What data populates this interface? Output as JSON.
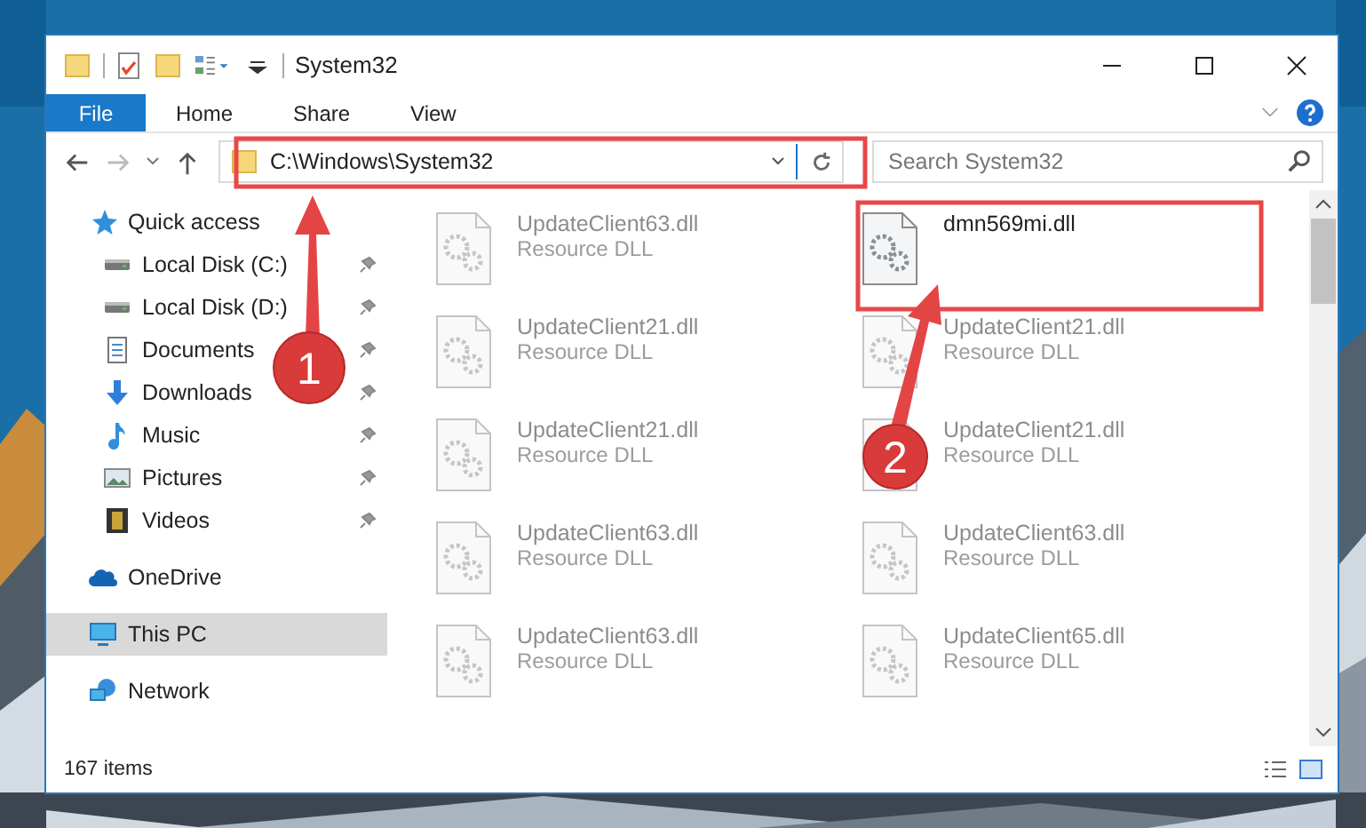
{
  "window": {
    "title": "System32"
  },
  "ribbon_tabs": [
    {
      "label": "File",
      "selected": true
    },
    {
      "label": "Home",
      "selected": false
    },
    {
      "label": "Share",
      "selected": false
    },
    {
      "label": "View",
      "selected": false
    }
  ],
  "address": {
    "value": "C:\\Windows\\System32"
  },
  "search": {
    "placeholder": "Search System32"
  },
  "sidebar": {
    "items": [
      {
        "label": "Quick access",
        "kind": "star",
        "selected": false,
        "children": [
          {
            "label": "Local Disk (C:)",
            "kind": "drive",
            "pinned": true
          },
          {
            "label": "Local Disk (D:)",
            "kind": "drive",
            "pinned": true
          },
          {
            "label": "Documents",
            "kind": "document",
            "pinned": true
          },
          {
            "label": "Downloads",
            "kind": "download",
            "pinned": true
          },
          {
            "label": "Music",
            "kind": "music",
            "pinned": true
          },
          {
            "label": "Pictures",
            "kind": "pictures",
            "pinned": true
          },
          {
            "label": "Videos",
            "kind": "video",
            "pinned": true
          }
        ]
      },
      {
        "label": "OneDrive",
        "kind": "cloud",
        "selected": false
      },
      {
        "label": "This PC",
        "kind": "monitor",
        "selected": true
      },
      {
        "label": "Network",
        "kind": "network",
        "selected": false
      }
    ]
  },
  "files": [
    {
      "name": "UpdateClient63.dll",
      "type": "Resource DLL",
      "blurred": true
    },
    {
      "name": "dmn569mi.dll",
      "blurred": false
    },
    {
      "name": "UpdateClient21.dll",
      "type": "Resource DLL",
      "blurred": true
    },
    {
      "name": "UpdateClient21.dll",
      "type": "Resource DLL",
      "blurred": true
    },
    {
      "name": "UpdateClient21.dll",
      "type": "Resource DLL",
      "blurred": true
    },
    {
      "name": "UpdateClient21.dll",
      "type": "Resource DLL",
      "blurred": true
    },
    {
      "name": "UpdateClient63.dll",
      "type": "Resource DLL",
      "blurred": true
    },
    {
      "name": "UpdateClient63.dll",
      "type": "Resource DLL",
      "blurred": true
    },
    {
      "name": "UpdateClient63.dll",
      "type": "Resource DLL",
      "blurred": true
    },
    {
      "name": "UpdateClient65.dll",
      "type": "Resource DLL",
      "blurred": true
    }
  ],
  "status_bar": {
    "item_count": "167 items"
  },
  "annotations": [
    {
      "label": "1"
    },
    {
      "label": "2"
    }
  ]
}
